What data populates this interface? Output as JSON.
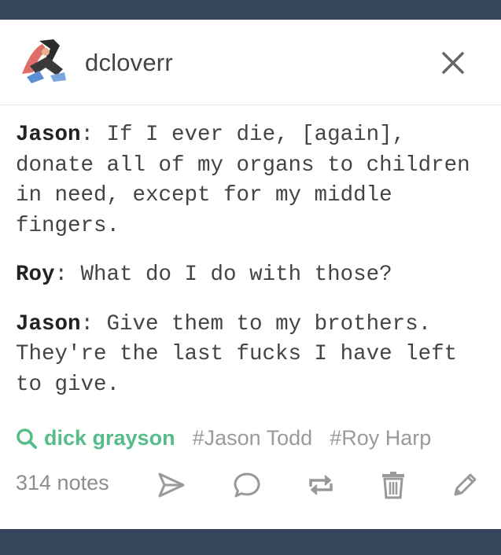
{
  "post": {
    "username": "dcloverr",
    "avatar_icon": "avatar-image",
    "close_icon": "close-icon",
    "body": [
      {
        "speaker": "Jason",
        "text": "If I ever die, [again], donate all of my organs to children in need, except for my middle fingers."
      },
      {
        "speaker": "Roy",
        "text": "What do I do with those?"
      },
      {
        "speaker": "Jason",
        "text": "Give them to my brothers. They're the last fucks I have left to give."
      }
    ],
    "tags": {
      "featured": "dick grayson",
      "list": [
        "#Jason Todd",
        "#Roy Harp"
      ]
    },
    "notes": "314 notes",
    "actions": [
      "share-icon",
      "reply-icon",
      "reblog-icon",
      "delete-icon",
      "edit-icon"
    ],
    "colors": {
      "frame": "#36465d",
      "featured_tag": "#56bc8a",
      "text": "#444444",
      "muted": "#9a9a9a"
    }
  }
}
